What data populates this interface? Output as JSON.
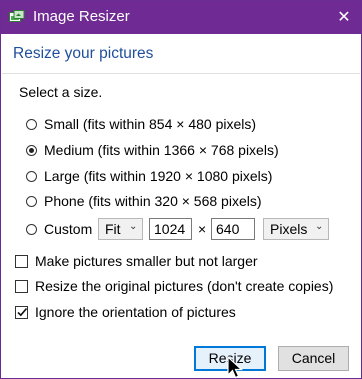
{
  "window": {
    "title": "Image Resizer",
    "close_glyph": "✕",
    "accent_color": "#6f2a93"
  },
  "heading": "Resize your pictures",
  "size_prompt": "Select a size.",
  "sizes": [
    {
      "label": "Small (fits within 854 × 480 pixels)",
      "checked": false
    },
    {
      "label": "Medium (fits within 1366 × 768 pixels)",
      "checked": true
    },
    {
      "label": "Large (fits within 1920 × 1080 pixels)",
      "checked": false
    },
    {
      "label": "Phone (fits within 320 × 568 pixels)",
      "checked": false
    }
  ],
  "custom": {
    "label": "Custom",
    "mode_value": "Fit",
    "width_value": "1024",
    "times_glyph": "×",
    "height_value": "640",
    "unit_value": "Pixels"
  },
  "options": [
    {
      "label": "Make pictures smaller but not larger",
      "checked": false
    },
    {
      "label": "Resize the original pictures (don't create copies)",
      "checked": false
    },
    {
      "label": "Ignore the orientation of pictures",
      "checked": true
    }
  ],
  "buttons": {
    "resize_label": "Resize",
    "cancel_label": "Cancel"
  },
  "icons": {
    "app": "image-resizer-icon",
    "chevron": "⌄"
  }
}
